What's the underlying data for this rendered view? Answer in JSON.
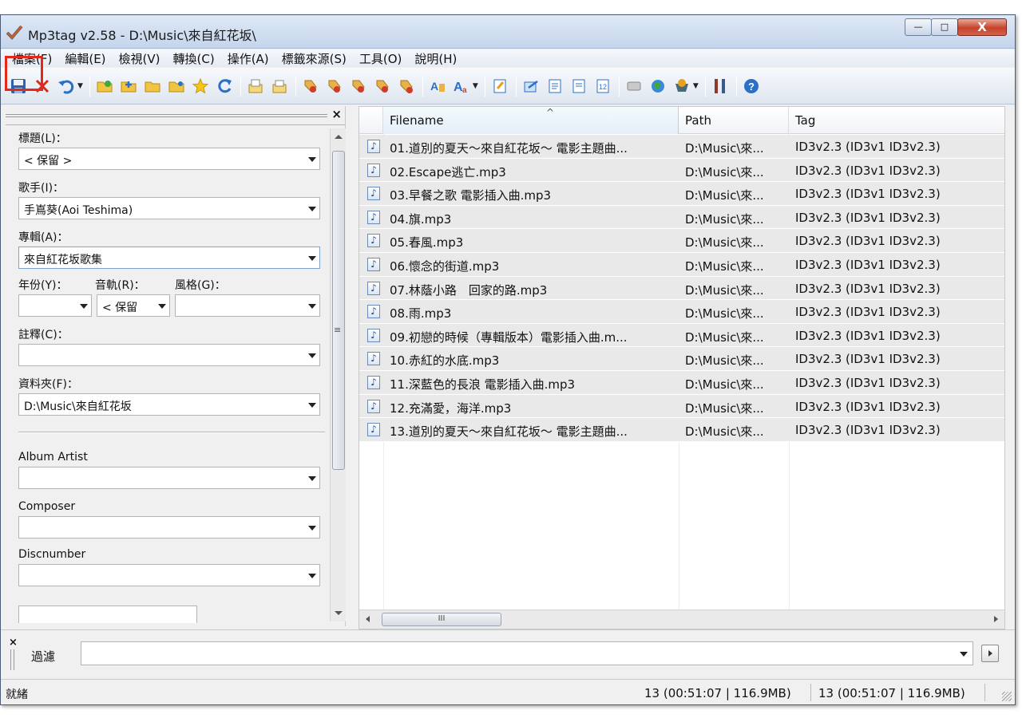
{
  "window": {
    "title": "Mp3tag v2.58  -  D:\\Music\\來自紅花坂\\",
    "buttons": {
      "minimize": "—",
      "maximize": "□",
      "close": "X"
    }
  },
  "menu": [
    "檔案(F)",
    "編輯(E)",
    "檢視(V)",
    "轉換(C)",
    "操作(A)",
    "標籤來源(S)",
    "工具(O)",
    "說明(H)"
  ],
  "toolbar": {
    "icons": [
      "save-icon",
      "remove-tag-icon",
      "undo-icon",
      "change-directory-icon",
      "add-directory-icon",
      "open-folder-icon",
      "folder-icon",
      "favorite-star-icon",
      "refresh-icon",
      "copy-tag-icon",
      "paste-tag-icon",
      "tag-to-filename-icon",
      "filename-to-tag-icon",
      "text-file-icon",
      "tag-tag-icon",
      "autonumber-icon",
      "actions-icon",
      "case-conversion-icon",
      "extended-tags-icon",
      "export-icon",
      "playlist-icon",
      "autonumber-wizard-icon",
      "freedb-icon",
      "web-sources-icon",
      "options-icon",
      "help-icon"
    ],
    "highlight_color": "#e5281c"
  },
  "tag_panel": {
    "fields": {
      "title": {
        "label": "標題(L)：",
        "value": "< 保留 >"
      },
      "artist": {
        "label": "歌手(I)：",
        "value": "手嶌葵(Aoi Teshima)"
      },
      "album": {
        "label": "專輯(A)：",
        "value": "來自紅花坂歌集"
      },
      "year": {
        "label": "年份(Y)：",
        "value": ""
      },
      "track": {
        "label": "音軌(R)：",
        "value": "< 保留"
      },
      "genre": {
        "label": "風格(G)：",
        "value": ""
      },
      "comment": {
        "label": "註釋(C)：",
        "value": ""
      },
      "directory": {
        "label": "資料夾(F)：",
        "value": "D:\\Music\\來自紅花坂"
      },
      "album_artist": {
        "label": "Album Artist",
        "value": ""
      },
      "composer": {
        "label": "Composer",
        "value": ""
      },
      "discnumber": {
        "label": "Discnumber",
        "value": ""
      }
    }
  },
  "file_list": {
    "columns": [
      "Filename",
      "Path",
      "Tag"
    ],
    "rows": [
      {
        "filename": "01.道別的夏天～來自紅花坂～ 電影主題曲...",
        "path": "D:\\Music\\來...",
        "tag": "ID3v2.3 (ID3v1 ID3v2.3)"
      },
      {
        "filename": "02.Escape逃亡.mp3",
        "path": "D:\\Music\\來...",
        "tag": "ID3v2.3 (ID3v1 ID3v2.3)"
      },
      {
        "filename": "03.早餐之歌 電影插入曲.mp3",
        "path": "D:\\Music\\來...",
        "tag": "ID3v2.3 (ID3v1 ID3v2.3)"
      },
      {
        "filename": "04.旗.mp3",
        "path": "D:\\Music\\來...",
        "tag": "ID3v2.3 (ID3v1 ID3v2.3)"
      },
      {
        "filename": "05.春風.mp3",
        "path": "D:\\Music\\來...",
        "tag": "ID3v2.3 (ID3v1 ID3v2.3)"
      },
      {
        "filename": "06.懷念的街道.mp3",
        "path": "D:\\Music\\來...",
        "tag": "ID3v2.3 (ID3v1 ID3v2.3)"
      },
      {
        "filename": "07.林蔭小路　回家的路.mp3",
        "path": "D:\\Music\\來...",
        "tag": "ID3v2.3 (ID3v1 ID3v2.3)"
      },
      {
        "filename": "08.雨.mp3",
        "path": "D:\\Music\\來...",
        "tag": "ID3v2.3 (ID3v1 ID3v2.3)"
      },
      {
        "filename": "09.初戀的時候（專輯版本）電影插入曲.m...",
        "path": "D:\\Music\\來...",
        "tag": "ID3v2.3 (ID3v1 ID3v2.3)"
      },
      {
        "filename": "10.赤紅的水底.mp3",
        "path": "D:\\Music\\來...",
        "tag": "ID3v2.3 (ID3v1 ID3v2.3)"
      },
      {
        "filename": "11.深藍色的長浪 電影插入曲.mp3",
        "path": "D:\\Music\\來...",
        "tag": "ID3v2.3 (ID3v1 ID3v2.3)"
      },
      {
        "filename": "12.充滿愛，海洋.mp3",
        "path": "D:\\Music\\來...",
        "tag": "ID3v2.3 (ID3v1 ID3v2.3)"
      },
      {
        "filename": "13.道別的夏天～來自紅花坂～ 電影主題曲...",
        "path": "D:\\Music\\來...",
        "tag": "ID3v2.3 (ID3v1 ID3v2.3)"
      }
    ],
    "hscroll_grip": "III"
  },
  "filter": {
    "label": "過濾",
    "value": ""
  },
  "status": {
    "left": "就緒",
    "selected": "13 (00:51:07 | 116.9MB)",
    "total": "13 (00:51:07 | 116.9MB)"
  }
}
